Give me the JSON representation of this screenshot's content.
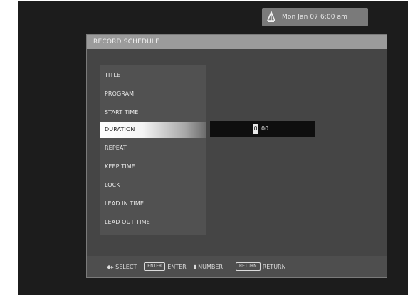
{
  "status": {
    "icon": "tv-antenna-icon",
    "datetime": "Mon Jan 07  6:00 am"
  },
  "dialog": {
    "title": "RECORD SCHEDULE",
    "menu_items": [
      {
        "label": "TITLE",
        "selected": false
      },
      {
        "label": "PROGRAM",
        "selected": false
      },
      {
        "label": "START TIME",
        "selected": false
      },
      {
        "label": "DURATION",
        "selected": true
      },
      {
        "label": "REPEAT",
        "selected": false
      },
      {
        "label": "KEEP TIME",
        "selected": false
      },
      {
        "label": "LOCK",
        "selected": false
      },
      {
        "label": "LEAD IN TIME",
        "selected": false
      },
      {
        "label": "LEAD OUT TIME",
        "selected": false
      }
    ],
    "duration_field": {
      "cursor_digit": "0",
      "value": "00"
    }
  },
  "footer": {
    "select_glyph": "◆▸",
    "select_label": "SELECT",
    "enter_key": "ENTER",
    "enter_label": "ENTER",
    "number_glyph": "▮",
    "number_label": "NUMBER",
    "return_key": "RETURN",
    "return_label": "RETURN"
  }
}
